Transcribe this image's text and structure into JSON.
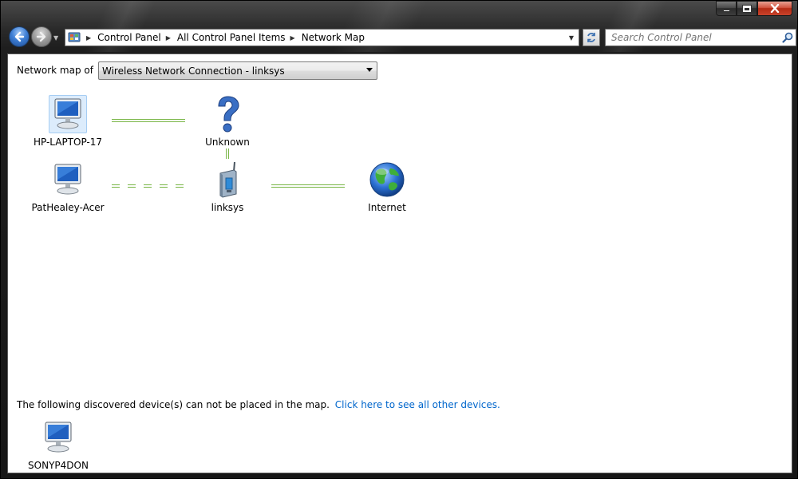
{
  "window": {
    "caption_buttons": {
      "minimize": "minimize",
      "maximize": "maximize",
      "close": "close"
    }
  },
  "nav": {
    "breadcrumbs": [
      "Control Panel",
      "All Control Panel Items",
      "Network Map"
    ],
    "search_placeholder": "Search Control Panel"
  },
  "content": {
    "map_of_label": "Network map of",
    "connection_selected": "Wireless Network Connection - linksys",
    "nodes": {
      "hp_laptop": "HP-LAPTOP-17",
      "unknown": "Unknown",
      "pathealey": "PatHealey-Acer",
      "linksys": "linksys",
      "internet": "Internet",
      "sony": "SONYP4DON"
    },
    "discovered_text": "The following discovered device(s) can not be placed in the map.",
    "discovered_link": "Click here to see all other devices."
  },
  "colors": {
    "link_line": "#7ab648",
    "link_text": "#0066cc",
    "selection_bg": "#dcecfc"
  },
  "icons": [
    "back-arrow-icon",
    "forward-arrow-icon",
    "control-panel-icon",
    "refresh-icon",
    "search-icon",
    "computer-icon",
    "question-mark-icon",
    "router-icon",
    "globe-icon"
  ]
}
